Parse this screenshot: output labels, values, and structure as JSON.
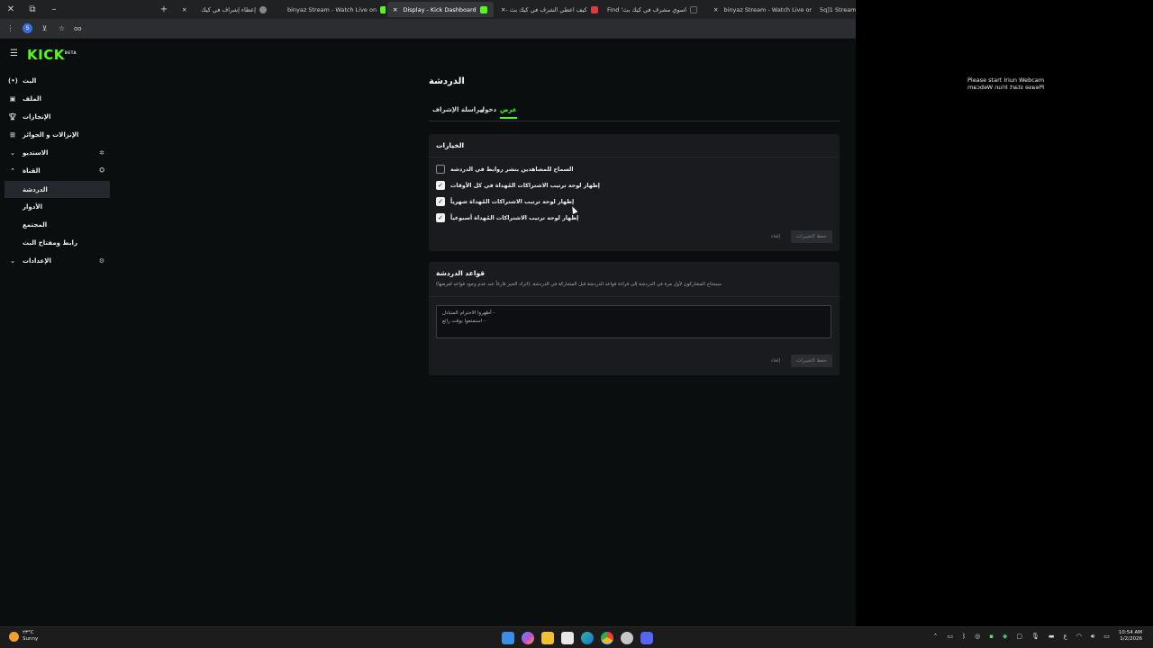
{
  "browser": {
    "tabs": [
      {
        "label": "إعطاء إشراف في كيك",
        "active": false
      },
      {
        "label": "binyaz Stream - Watch Live on",
        "active": false
      },
      {
        "label": "Display - Kick Dashboard",
        "active": true
      },
      {
        "label": "كيف اعطي الشرف في كيك بث -",
        "active": false
      },
      {
        "label": "Find 'اسوي مشرف في كيك بث",
        "active": false
      },
      {
        "label": "binyaz Stream - Watch Live on",
        "active": false
      },
      {
        "label": "5q]1 Stream",
        "active": false
      }
    ],
    "address_text": "oo"
  },
  "brand": {
    "logo_text": "KICK",
    "logo_sup": "BETA",
    "accent": "#53fc18"
  },
  "sidebar": {
    "items": [
      {
        "label": "البث",
        "icon": "live-icon"
      },
      {
        "label": "الملف",
        "icon": "profile-icon"
      },
      {
        "label": "الإنجازات",
        "icon": "trophy-icon"
      },
      {
        "label": "الإنزالات و الجوائز",
        "icon": "gift-icon"
      },
      {
        "label": "الاستديو",
        "icon": "chevron-down-icon"
      },
      {
        "label": "القناة",
        "icon": "chevron-up-icon"
      },
      {
        "label": "الدردشة",
        "icon": ""
      },
      {
        "label": "الأدوار",
        "icon": ""
      },
      {
        "label": "المجتمع",
        "icon": ""
      },
      {
        "label": "رابط ومفتاح البث",
        "icon": ""
      },
      {
        "label": "الإعدادات",
        "icon": "chevron-down-icon"
      }
    ]
  },
  "main": {
    "title": "الدردشة",
    "tabs": {
      "display": "عرض",
      "login": "دخول",
      "mod_messages": "مراسلة الإشراف"
    },
    "options_card": {
      "heading": "الخيارات",
      "options": [
        {
          "label": "السماح للمشاهدين بنشر روابط في الدردشة",
          "checked": false
        },
        {
          "label": "إظهار لوحة ترتيب الاشتراكات المُهداة في كل الأوقات",
          "checked": true
        },
        {
          "label": "إظهار لوحة ترتيب الاشتراكات المُهداة شهرياً",
          "checked": true
        },
        {
          "label": "إظهار لوحة ترتيب الاشتراكات المُهداة أسبوعياً",
          "checked": true
        }
      ],
      "save_label": "حفظ التغييرات",
      "cancel_label": "إلغاء"
    },
    "rules_card": {
      "heading": "قواعد الدردشة",
      "description": "سيحتاج المشاركون لأول مرة في الدردشة إلى قراءة قواعد الدردشة قبل المشاركة في الدردشة. (اترك الحيز فارغاً عند عدم وجود قواعد لعرضها)",
      "rules_lines": [
        "- أظهروا الاحترام المتبادل",
        "- استمتعوا بوقت رائع"
      ],
      "save_label": "حفظ التغييرات",
      "cancel_label": "إلغاء"
    }
  },
  "webcam": {
    "line1": "Please start Iriun Webcam",
    "line2": "Please start Iriun Webcam"
  },
  "taskbar": {
    "weather_temp": "٢٣°C",
    "weather_desc": "Sunny",
    "time": "10:54 AM",
    "date": "1/2/2026",
    "lang": "ع"
  }
}
